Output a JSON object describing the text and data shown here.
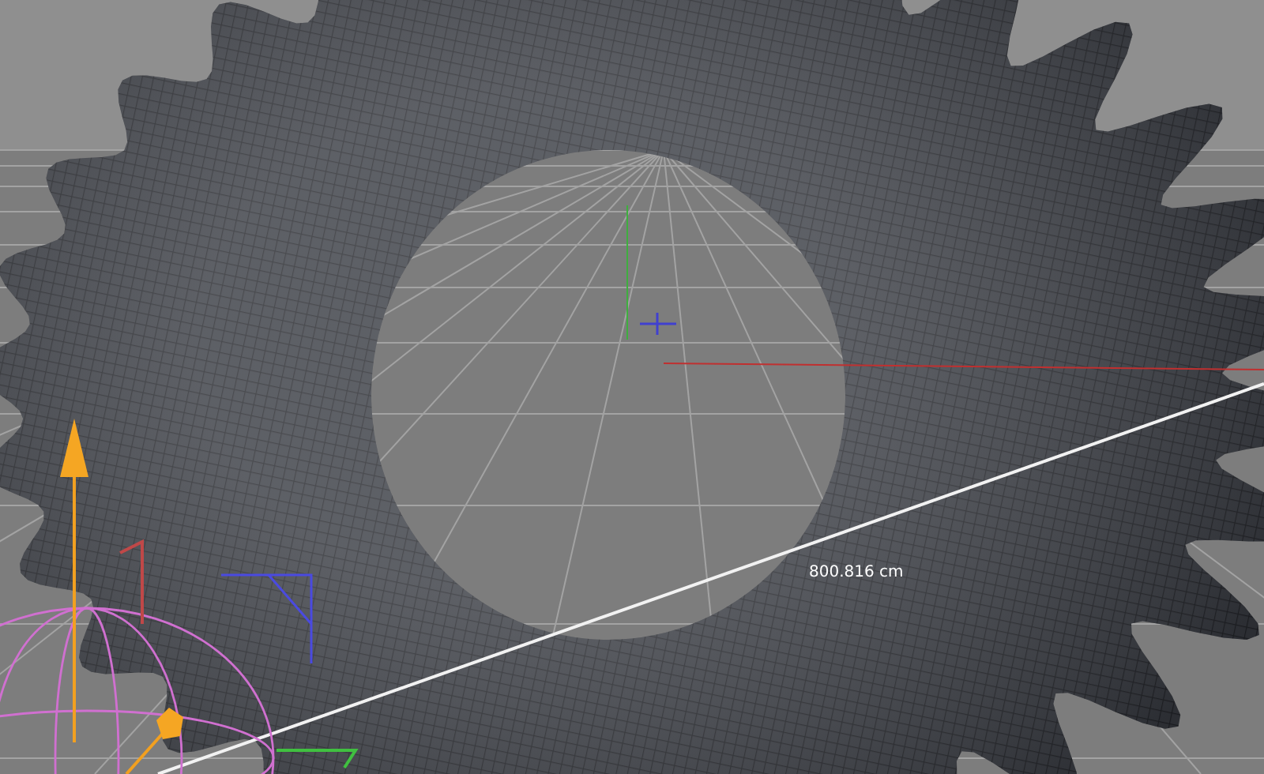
{
  "viewport": {
    "measurement": {
      "label": "800.816 cm"
    }
  }
}
